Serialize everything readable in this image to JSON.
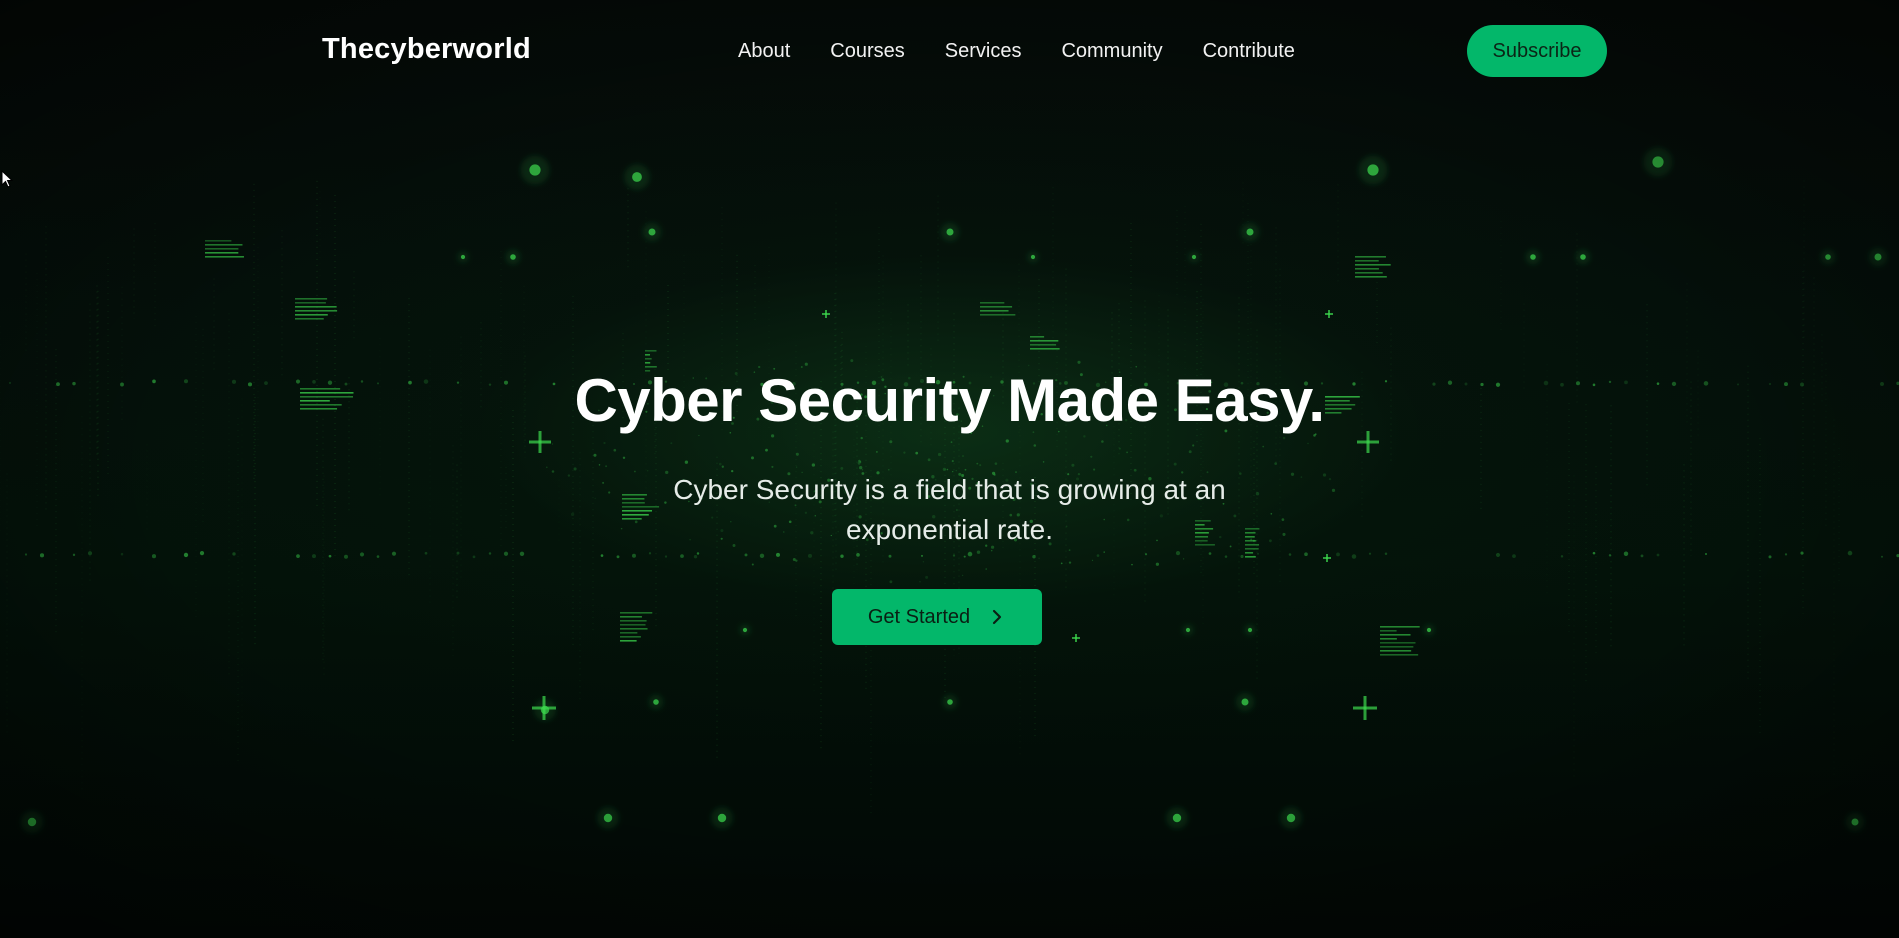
{
  "header": {
    "logo": "Thecyberworld",
    "nav": [
      {
        "label": "About"
      },
      {
        "label": "Courses"
      },
      {
        "label": "Services"
      },
      {
        "label": "Community"
      },
      {
        "label": "Contribute"
      }
    ],
    "subscribe_label": "Subscribe"
  },
  "hero": {
    "title": "Cyber Security Made Easy.",
    "subtitle": "Cyber Security is a field that is growing at an exponential rate.",
    "cta_label": "Get Started",
    "cta_icon": "chevron-right-icon"
  },
  "colors": {
    "accent": "#03b76a",
    "background": "#030806",
    "matrix_green": "#3ddc4f"
  }
}
